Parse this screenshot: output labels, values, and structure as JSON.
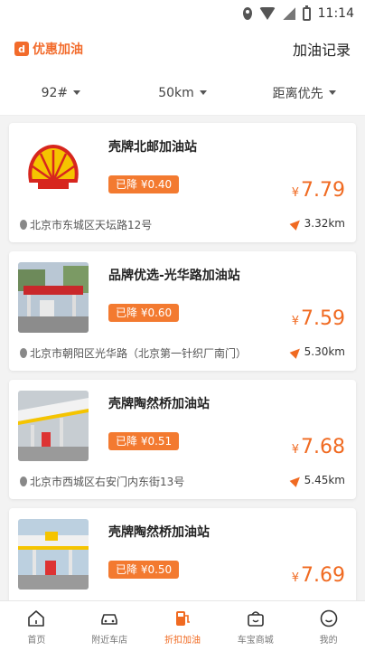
{
  "status": {
    "time": "11:14"
  },
  "header": {
    "brand": "优惠加油",
    "brand_icon": "gas-icon",
    "record_link": "加油记录"
  },
  "filters": [
    {
      "label": "92#"
    },
    {
      "label": "50km"
    },
    {
      "label": "距离优先"
    }
  ],
  "stations": [
    {
      "name": "壳牌北邮加油站",
      "discount": "已降 ¥0.40",
      "currency": "¥",
      "price": "7.79",
      "address": "北京市东城区天坛路12号",
      "distance": "3.32km",
      "thumb": "shell-logo"
    },
    {
      "name": "品牌优选-光华路加油站",
      "discount": "已降 ¥0.60",
      "currency": "¥",
      "price": "7.59",
      "address": "北京市朝阳区光华路（北京第一针织厂南门）",
      "distance": "5.30km",
      "thumb": "station-photo"
    },
    {
      "name": "壳牌陶然桥加油站",
      "discount": "已降 ¥0.51",
      "currency": "¥",
      "price": "7.68",
      "address": "北京市西城区右安门内东街13号",
      "distance": "5.45km",
      "thumb": "station-photo"
    },
    {
      "name": "壳牌陶然桥加油站",
      "discount": "已降 ¥0.50",
      "currency": "¥",
      "price": "7.69",
      "address": "",
      "distance": "",
      "thumb": "station-photo"
    }
  ],
  "tabs": [
    {
      "label": "首页",
      "icon": "home-icon"
    },
    {
      "label": "附近车店",
      "icon": "car-icon"
    },
    {
      "label": "折扣加油",
      "icon": "fuel-pump-icon",
      "active": true
    },
    {
      "label": "车宝商城",
      "icon": "shop-bag-icon"
    },
    {
      "label": "我的",
      "icon": "profile-icon"
    }
  ],
  "colors": {
    "accent": "#f06a21",
    "discount_bg": "#f37a30"
  }
}
